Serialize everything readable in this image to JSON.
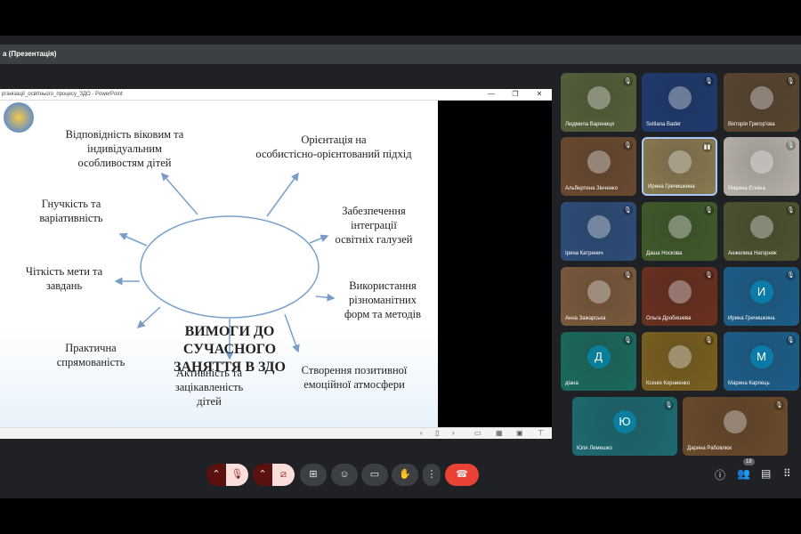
{
  "meeting": {
    "presentation_title": "а (Презентація)",
    "participant_count": "18"
  },
  "ppt": {
    "window_title": "рганізації_освітнього_процесу_ЗДО - PowerPoint",
    "min": "—",
    "max": "❐",
    "close": "✕"
  },
  "slide": {
    "center": "ВИМОГИ ДО СУЧАСНОГО ЗАНЯТТЯ В ЗДО",
    "items": [
      "Відповідність віковим та\nіндивідуальним\nособливостям дітей",
      "Орієнтація на\nособистісно-орієнтований підхід",
      "Гнучкість та\nваріативність",
      "Забезпечення\nінтеграції\nосвітніх галузей",
      "Чіткість мети та\nзавдань",
      "Використання\nрізноманітних\nформ та методів",
      "Практична\nспрямованість",
      "Активність та\nзацікавленість\nдітей",
      "Створення позитивної\nемоційної атмосфери"
    ]
  },
  "participants": [
    {
      "name": "Людмила Варяниця",
      "bg": "#55603a",
      "av": ""
    },
    {
      "name": "Svitlana Bader",
      "bg": "#1f3a6e",
      "av": ""
    },
    {
      "name": "Вікторія Григор'єва",
      "bg": "#5a4630",
      "av": ""
    },
    {
      "name": "Альбертина Зінченко",
      "bg": "#6a4a30",
      "av": ""
    },
    {
      "name": "Ирина Гречишкина",
      "bg": "#8a7a50",
      "av": ""
    },
    {
      "name": "Марина Єлкіна",
      "bg": "#b9b3aa",
      "av": ""
    },
    {
      "name": "Ірина Катренич",
      "bg": "#2e4d7a",
      "av": ""
    },
    {
      "name": "Даша Носкова",
      "bg": "#3f5a2a",
      "av": ""
    },
    {
      "name": "Анжелика Нагорняк",
      "bg": "#4c5430",
      "av": ""
    },
    {
      "name": "Анна Зажарська",
      "bg": "#7a5a3c",
      "av": ""
    },
    {
      "name": "Ольга Дробишева",
      "bg": "#6a3020",
      "av": ""
    },
    {
      "name": "Ирина Гречишкина",
      "bg": "#1d5e8a",
      "av": "И"
    },
    {
      "name": "діана",
      "bg": "#1b6a5e",
      "av": "Д"
    },
    {
      "name": "Ксенія Корниенко",
      "bg": "#7a6020",
      "av": ""
    },
    {
      "name": "Марина Карпець",
      "bg": "#1d5e8a",
      "av": "М"
    },
    {
      "name": "Юля Лемешко",
      "bg": "#1d6a70",
      "av": "Ю"
    },
    {
      "name": "Дарина Рабовлюк",
      "bg": "#6a4a2a",
      "av": ""
    }
  ]
}
